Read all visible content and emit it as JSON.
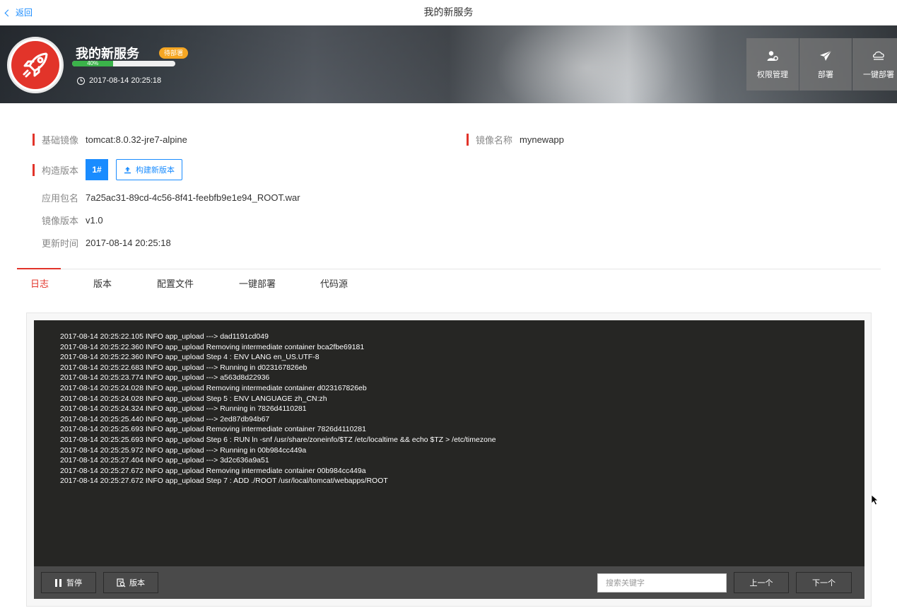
{
  "nav": {
    "back_label": "返回",
    "title": "我的新服务"
  },
  "service": {
    "name": "我的新服务",
    "status": "待部署",
    "progress_label": "40%",
    "progress": 0.4,
    "updated": "2017-08-14 20:25:18",
    "accent_color": "#e2342a"
  },
  "actions": [
    {
      "label": "权限管理",
      "icon": "user-gear-icon"
    },
    {
      "label": "部署",
      "icon": "paper-plane-icon"
    },
    {
      "label": "一键部署",
      "icon": "cloud-icon"
    }
  ],
  "info": {
    "base_image_label": "基础镜像",
    "base_image": "tomcat:8.0.32-jre7-alpine",
    "image_name_label": "镜像名称",
    "image_name": "mynewapp",
    "build_version_label": "构造版本",
    "build_version": "1#",
    "build_button": "构建新版本",
    "package_label": "应用包名",
    "package": "7a25ac31-89cd-4c56-8f41-feebfb9e1e94_ROOT.war",
    "image_version_label": "镜像版本",
    "image_version": "v1.0",
    "update_time_label": "更新时间",
    "update_time": "2017-08-14 20:25:18"
  },
  "tabs": [
    "日志",
    "版本",
    "配置文件",
    "一键部署",
    "代码源"
  ],
  "active_tab": "日志",
  "log": {
    "lines": [
      "2017-08-14 20:25:22.105 INFO app_upload ---> dad1191cd049",
      "2017-08-14 20:25:22.360 INFO app_upload Removing intermediate container bca2fbe69181",
      "2017-08-14 20:25:22.360 INFO app_upload Step 4 : ENV LANG en_US.UTF-8",
      "2017-08-14 20:25:22.683 INFO app_upload ---> Running in d023167826eb",
      "2017-08-14 20:25:23.774 INFO app_upload ---> a563d8d22936",
      "2017-08-14 20:25:24.028 INFO app_upload Removing intermediate container d023167826eb",
      "2017-08-14 20:25:24.028 INFO app_upload Step 5 : ENV LANGUAGE zh_CN:zh",
      "2017-08-14 20:25:24.324 INFO app_upload ---> Running in 7826d4110281",
      "2017-08-14 20:25:25.440 INFO app_upload ---> 2ed87db94b67",
      "2017-08-14 20:25:25.693 INFO app_upload Removing intermediate container 7826d4110281",
      "2017-08-14 20:25:25.693 INFO app_upload Step 6 : RUN ln -snf /usr/share/zoneinfo/$TZ /etc/localtime && echo $TZ > /etc/timezone",
      "2017-08-14 20:25:25.972 INFO app_upload ---> Running in 00b984cc449a",
      "2017-08-14 20:25:27.404 INFO app_upload ---> 3d2c636a9a51",
      "2017-08-14 20:25:27.672 INFO app_upload Removing intermediate container 00b984cc449a",
      "2017-08-14 20:25:27.672 INFO app_upload Step 7 : ADD ./ROOT /usr/local/tomcat/webapps/ROOT"
    ],
    "pause_label": "暂停",
    "version_label": "版本",
    "search_placeholder": "搜索关键字",
    "search_value": "",
    "prev_label": "上一个",
    "next_label": "下一个"
  }
}
